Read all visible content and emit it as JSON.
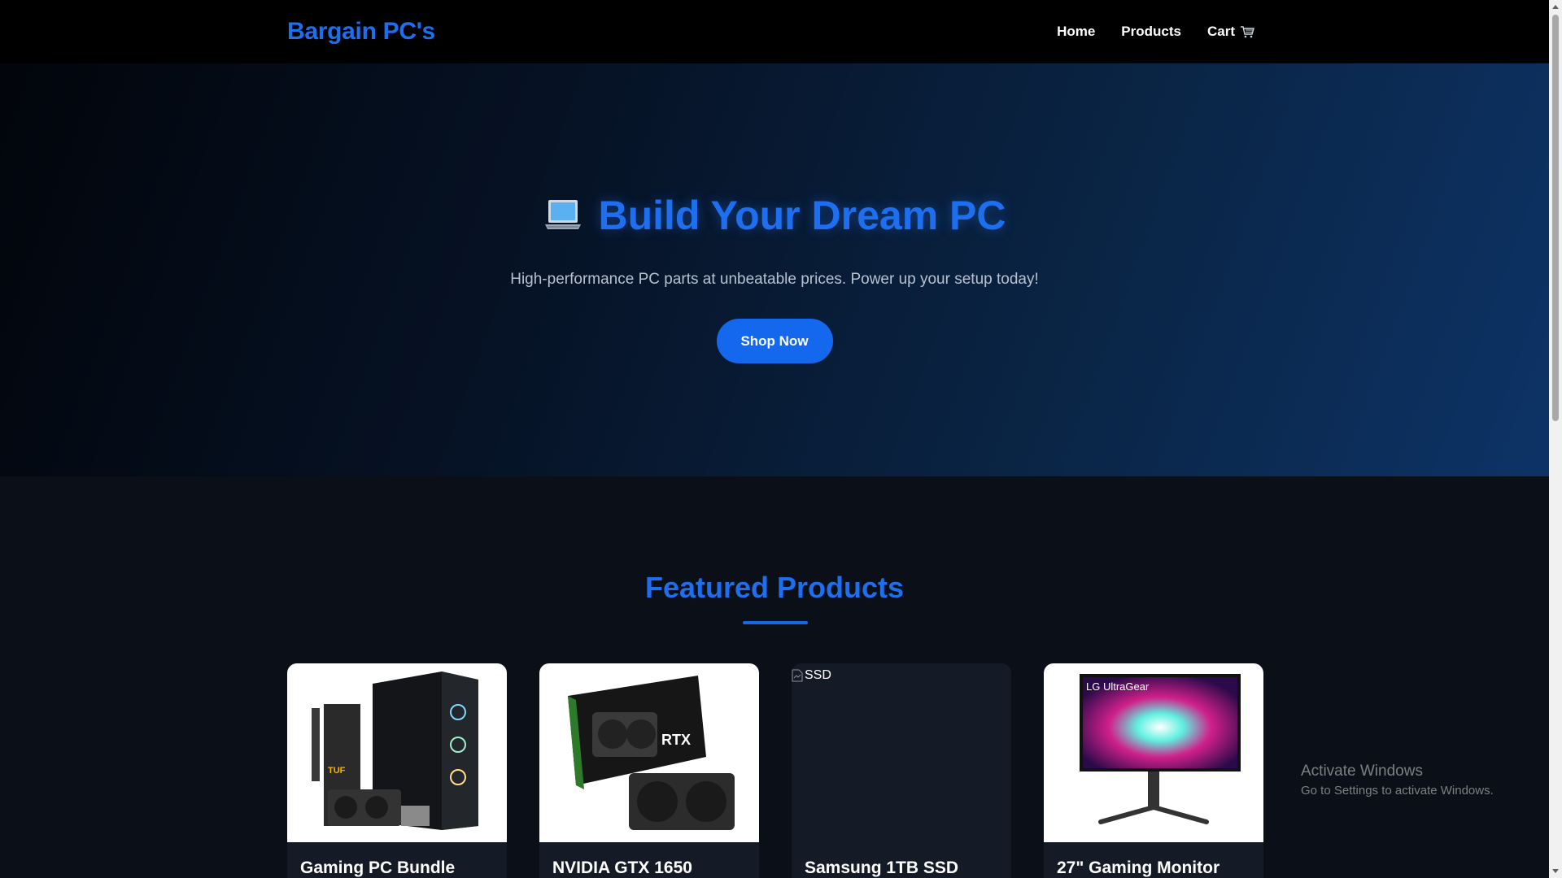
{
  "navbar": {
    "brand": "Bargain PC's",
    "links": [
      {
        "label": "Home"
      },
      {
        "label": "Products"
      },
      {
        "label": "Cart",
        "icon": "cart-icon"
      }
    ]
  },
  "hero": {
    "icon": "laptop-icon",
    "title": "Build Your Dream PC",
    "subtitle": "High-performance PC parts at unbeatable prices. Power up your setup today!",
    "cta_label": "Shop Now"
  },
  "featured": {
    "title": "Featured Products",
    "products": [
      {
        "name": "Gaming PC Bundle",
        "image": "gaming-pc-bundle-image"
      },
      {
        "name": "NVIDIA GTX 1650",
        "image": "graphics-card-image"
      },
      {
        "name": "Samsung 1TB SSD",
        "image_alt": "SSD",
        "image_broken": true
      },
      {
        "name": "27\" Gaming Monitor",
        "image": "monitor-image",
        "image_text": "LG UltraGear"
      }
    ]
  },
  "watermark": {
    "title": "Activate Windows",
    "subtitle": "Go to Settings to activate Windows."
  },
  "colors": {
    "accent": "#1e6ff0",
    "button": "#1468ee",
    "navbar_bg": "#000000",
    "page_bg": "#0b0f17",
    "card_bg": "#151b26"
  }
}
